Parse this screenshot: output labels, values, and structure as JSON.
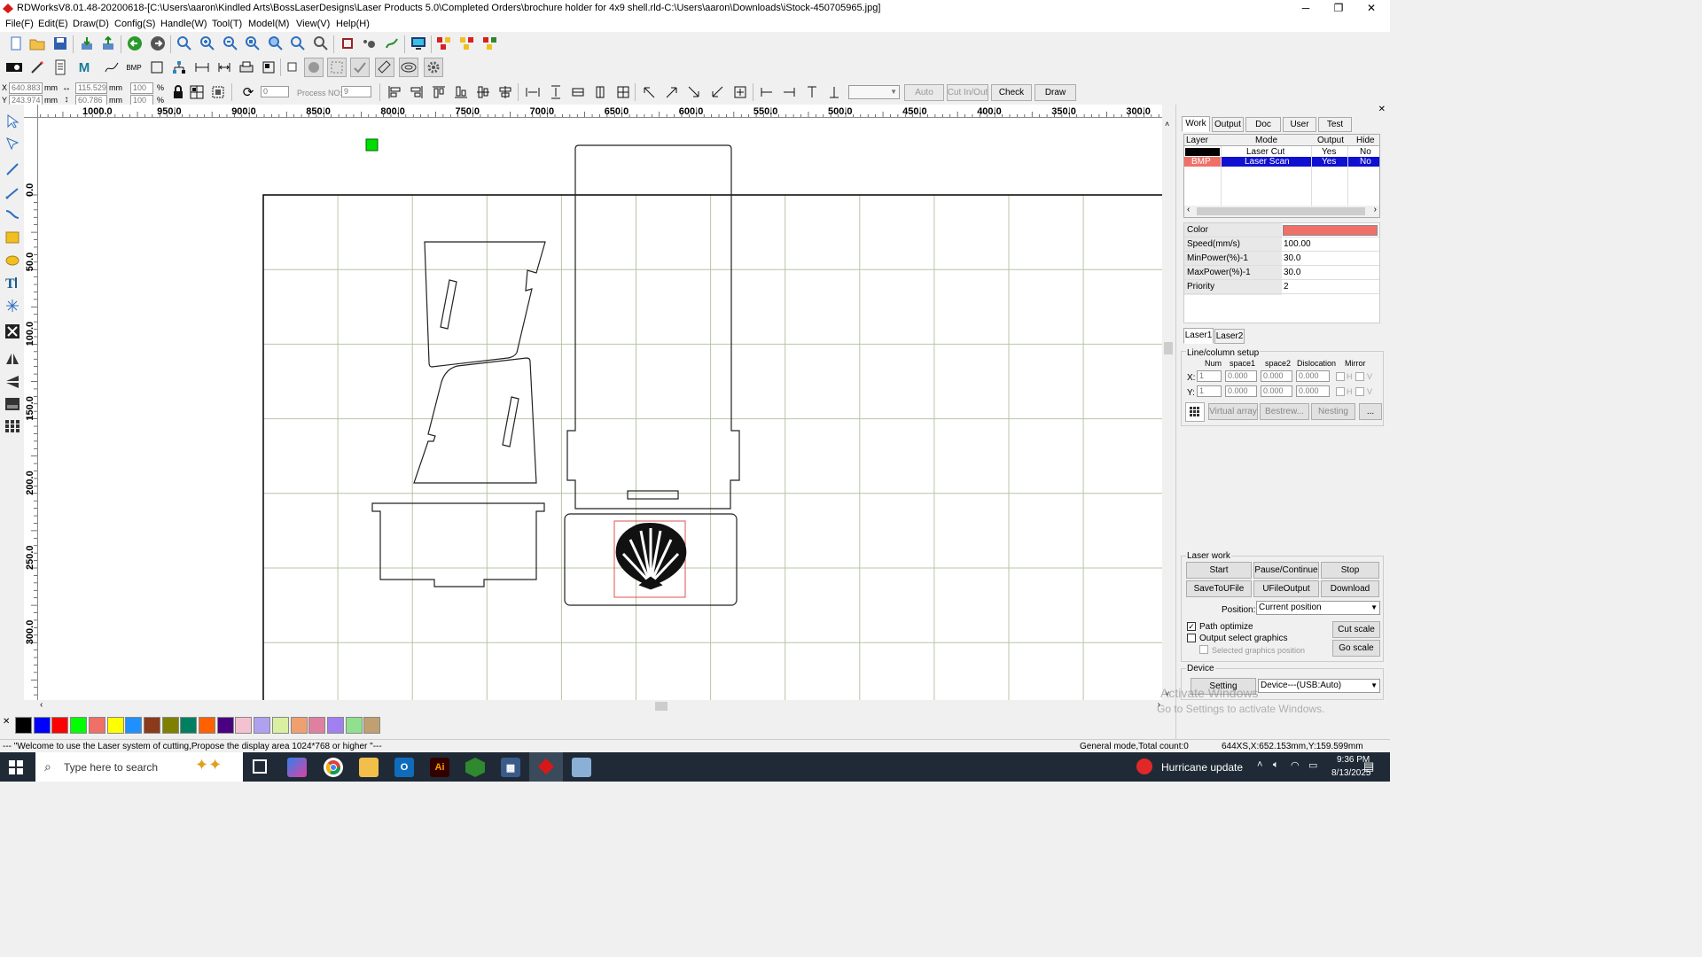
{
  "window": {
    "title": "RDWorksV8.01.48-20200618-[C:\\Users\\aaron\\Kindled Arts\\BossLaserDesigns\\Laser Products 5.0\\Completed Orders\\brochure holder for 4x9 shell.rld-C:\\Users\\aaron\\Downloads\\iStock-450705965.jpg]",
    "minimize": "─",
    "maximize": "❐",
    "close": "✕"
  },
  "menu": [
    "File(F)",
    "Edit(E)",
    "Draw(D)",
    "Config(S)",
    "Handle(W)",
    "Tool(T)",
    "Model(M)",
    "View(V)",
    "Help(H)"
  ],
  "coords": {
    "x_label": "X",
    "x_value": "640.883",
    "x_unit": "mm",
    "y_label": "Y",
    "y_value": "243.974",
    "y_unit": "mm",
    "w_value": "115.529",
    "w_unit": "mm",
    "h_value": "60.786",
    "h_unit": "mm",
    "sx_value": "100",
    "sx_unit": "%",
    "sy_value": "100",
    "sy_unit": "%",
    "rotate_value": "0",
    "process_no_label": "Process NO:",
    "process_no_value": "9"
  },
  "toolbar3_buttons": {
    "auto": "Auto",
    "cut_in_out": "Cut In/Out",
    "check": "Check",
    "draw": "Draw"
  },
  "ruler": {
    "h_labels": [
      "1000.0",
      "950.0",
      "900.0",
      "850.0",
      "800.0",
      "750.0",
      "700.0",
      "650.0",
      "600.0",
      "550.0",
      "500.0",
      "450.0",
      "400.0",
      "350.0",
      "300.0"
    ],
    "v_labels": [
      "0.0",
      "50.0",
      "100.0",
      "150.0",
      "200.0",
      "250.0",
      "300.0"
    ]
  },
  "panel": {
    "tabs": [
      "Work",
      "Output",
      "Doc",
      "User",
      "Test"
    ],
    "layer_headers": [
      "Layer",
      "Mode",
      "Output",
      "Hide"
    ],
    "layers": [
      {
        "layer": "",
        "mode": "Laser Cut",
        "output": "Yes",
        "hide": "No",
        "color": "#000000"
      },
      {
        "layer": "BMP",
        "mode": "Laser Scan",
        "output": "Yes",
        "hide": "No",
        "color": "#f07068"
      }
    ],
    "props": [
      {
        "name": "Color",
        "value": ""
      },
      {
        "name": "Speed(mm/s)",
        "value": "100.00"
      },
      {
        "name": "MinPower(%)-1",
        "value": "30.0"
      },
      {
        "name": "MaxPower(%)-1",
        "value": "30.0"
      },
      {
        "name": "Priority",
        "value": "2"
      }
    ],
    "laser_tabs": [
      "Laser1",
      "Laser2"
    ],
    "array": {
      "title": "Line/column setup",
      "headers": [
        "Num",
        "space1",
        "space2",
        "Dislocation",
        "Mirror"
      ],
      "x_label": "X:",
      "y_label": "Y:",
      "x_values": [
        "1",
        "0.000",
        "0.000",
        "0.000"
      ],
      "y_values": [
        "1",
        "0.000",
        "0.000",
        "0.000"
      ],
      "h_label": "H",
      "v_label": "V",
      "buttons": [
        "Virtual array",
        "Bestrew...",
        "Nesting",
        "..."
      ]
    },
    "laser_work": {
      "title": "Laser work",
      "buttons": [
        "Start",
        "Pause/Continue",
        "Stop",
        "SaveToUFile",
        "UFileOutput",
        "Download"
      ],
      "position_label": "Position:",
      "position_value": "Current position",
      "path_optimize": "Path optimize",
      "output_select": "Output select graphics",
      "selected_position": "Selected graphics position",
      "cut_scale": "Cut scale",
      "go_scale": "Go scale"
    },
    "device": {
      "title": "Device",
      "setting": "Setting",
      "value": "Device---(USB:Auto)"
    },
    "activate": {
      "line1": "Activate Windows",
      "line2": "Go to Settings to activate Windows."
    }
  },
  "palette": [
    "#000000",
    "#0000ff",
    "#ff0000",
    "#00ff00",
    "#f07068",
    "#ffff00",
    "#1e90ff",
    "#8b3a1a",
    "#808000",
    "#008060",
    "#ff6000",
    "#4b0082",
    "#f5c0d0",
    "#b0a0f0",
    "#d8f0a0",
    "#f0a070",
    "#e080a0",
    "#a080f0",
    "#90e090",
    "#c0a070"
  ],
  "status": {
    "message": "--- \"Welcome to use the Laser system of cutting,Propose the display area 1024*768 or higher \"---",
    "mode": "General mode,Total count:0",
    "cursor": "644XS,X:652.153mm,Y:159.599mm"
  },
  "taskbar": {
    "search_placeholder": "Type here to search",
    "news": "Hurricane update",
    "time": "9:36 PM",
    "date": "8/13/2025"
  }
}
